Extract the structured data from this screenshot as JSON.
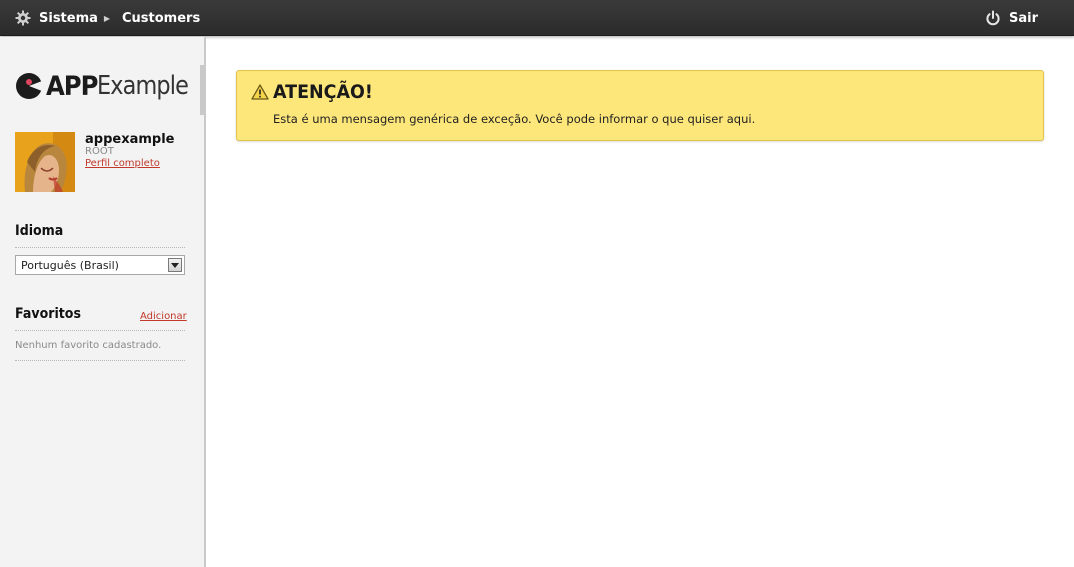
{
  "topbar": {
    "sistema_label": "Sistema",
    "sistema_icon": "gear-icon",
    "customers_label": "Customers",
    "sair_label": "Sair",
    "sair_icon": "power-icon"
  },
  "sidebar": {
    "logo": {
      "app": "APP",
      "example": "Example"
    },
    "profile": {
      "name": "appexample",
      "role": "ROOT",
      "link": "Perfil completo"
    },
    "idioma": {
      "title": "Idioma",
      "selected": "Português (Brasil)"
    },
    "favoritos": {
      "title": "Favoritos",
      "add_label": "Adicionar",
      "empty_text": "Nenhum favorito cadastrado."
    }
  },
  "alert": {
    "title": "ATENÇÃO!",
    "message": "Esta é uma mensagem genérica de exceção. Você pode informar o que quiser aqui.",
    "background": "#fde77a",
    "border": "#e0c349"
  },
  "colors": {
    "topbar": "#2f2f2f",
    "link": "#c0392b",
    "sidebar_bg": "#f3f3f3"
  }
}
